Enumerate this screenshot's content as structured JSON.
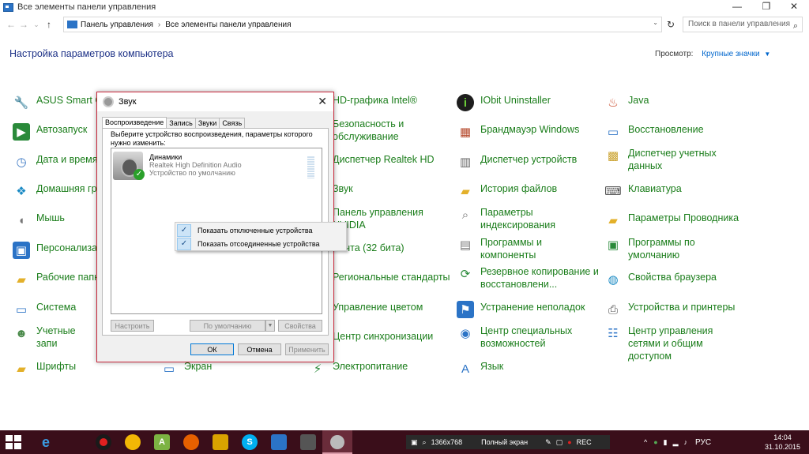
{
  "window": {
    "title": "Все элементы панели управления",
    "ctl_min": "—",
    "ctl_max": "❐",
    "ctl_close": "✕"
  },
  "nav": {
    "back": "←",
    "forward": "→",
    "recent": "⌄",
    "up": "↑",
    "address": [
      "Панель управления",
      "Все элементы панели управления"
    ],
    "sep": "›",
    "dropdown": "⌄",
    "refresh": "↻",
    "search_placeholder": "Поиск в панели управления",
    "search_icon": "⌕"
  },
  "header": {
    "title": "Настройка параметров компьютера",
    "view_label": "Просмотр:",
    "view_value": "Крупные значки",
    "view_arrow": "▼"
  },
  "items": {
    "c1": [
      "ASUS Smart G",
      "Автозапуск",
      "Дата и время",
      "Домашняя гру",
      "Мышь",
      "Персонализа",
      "Рабочие папк",
      "Система",
      "Учетные запи пользовател",
      "Шрифты"
    ],
    "c2": [
      "Экран"
    ],
    "c3": [
      "HD-графика Intel®",
      "Безопасность и обслуживание",
      "Диспетчер Realtek HD",
      "Звук",
      "Панель управления NVIDIA",
      "Почта (32 бита)",
      "Региональные стандарты",
      "Управление цветом",
      "Центр синхронизации",
      "Электропитание"
    ],
    "c4": [
      "IObit Uninstaller",
      "Брандмауэр Windows",
      "Диспетчер устройств",
      "История файлов",
      "Параметры индексирования",
      "Программы и компоненты",
      "Резервное копирование и восстановлени...",
      "Устранение неполадок",
      "Центр специальных возможностей",
      "Язык"
    ],
    "c5": [
      "Java",
      "Восстановление",
      "Диспетчер учетных данных",
      "Клавиатура",
      "Параметры Проводника",
      "Программы по умолчанию",
      "Свойства браузера",
      "Устройства и принтеры",
      "Центр управления сетями и общим доступом"
    ]
  },
  "icons": {
    "c1": [
      "wrench-icon",
      "autoplay-icon",
      "clock-icon",
      "homegroup-icon",
      "mouse-icon",
      "personalization-icon",
      "work-folders-icon",
      "system-icon",
      "users-icon",
      "fonts-icon"
    ],
    "c3": [
      "intel-graphics-icon",
      "security-flag-icon",
      "realtek-icon",
      "speaker-icon",
      "nvidia-icon",
      "mail-icon",
      "region-icon",
      "color-icon",
      "sync-icon",
      "power-icon"
    ],
    "c4": [
      "iobit-icon",
      "firewall-icon",
      "device-manager-icon",
      "file-history-icon",
      "indexing-icon",
      "programs-icon",
      "backup-icon",
      "troubleshooting-icon",
      "ease-of-access-icon",
      "language-icon"
    ],
    "c5": [
      "java-icon",
      "recovery-icon",
      "credential-icon",
      "keyboard-icon",
      "folder-options-icon",
      "default-programs-icon",
      "internet-options-icon",
      "printers-icon",
      "network-center-icon"
    ]
  },
  "dialog": {
    "title": "Звук",
    "close": "✕",
    "tabs": [
      "Воспроизведение",
      "Запись",
      "Звуки",
      "Связь"
    ],
    "instruction": "Выберите устройство воспроизведения, параметры которого нужно изменить:",
    "device": {
      "name": "Динамики",
      "driver": "Realtek High Definition Audio",
      "status": "Устройство по умолчанию",
      "check": "✓"
    },
    "buttons": {
      "configure": "Настроить",
      "default": "По умолчанию",
      "properties": "Свойства",
      "ok": "ОК",
      "cancel": "Отмена",
      "apply": "Применить",
      "arrow": "▼"
    }
  },
  "context_menu": {
    "items": [
      "Показать отключенные устройства",
      "Показать отсоединенные устройства"
    ],
    "check": "✓"
  },
  "recorder": {
    "resolution": "1366x768",
    "mode": "Полный экран",
    "rec": "REC"
  },
  "taskbar": {
    "lang": "РУС",
    "time": "14:04",
    "date": "31.10.2015",
    "tray_up": "^",
    "app_a": "A",
    "app_s": "S"
  }
}
